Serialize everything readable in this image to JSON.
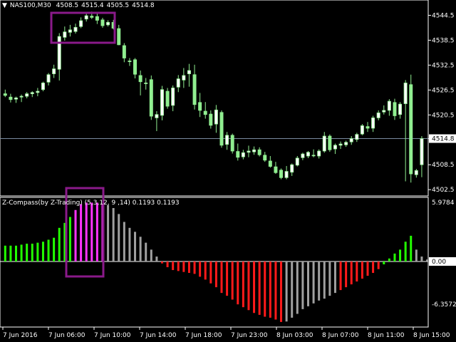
{
  "header": {
    "symbol_timeframe": "NAS100,M30",
    "ohlc": [
      "4508.5",
      "4515.4",
      "4505.5",
      "4514.8"
    ]
  },
  "price_axis": {
    "ticks": [
      "4544.5",
      "4538.5",
      "4532.5",
      "4526.5",
      "4520.5",
      "4514.8",
      "4508.5",
      "4502.5"
    ],
    "current_price": "4514.8"
  },
  "indicator": {
    "label": "Z-Compass(by Z-Trading) (5,3,12, 9 ,14) 0.1193 0.1193",
    "axis_ticks": [
      "5.9784",
      "0.00",
      "-6.3572"
    ]
  },
  "time_axis": {
    "labels": [
      "7 Jun 2016",
      "7 Jun 06:00",
      "7 Jun 10:00",
      "7 Jun 14:00",
      "7 Jun 18:00",
      "7 Jun 23:00",
      "8 Jun 03:00",
      "8 Jun 07:00",
      "8 Jun 11:00",
      "8 Jun 15:00"
    ]
  },
  "colors": {
    "background": "#000000",
    "bull_candle": "#ffffff",
    "bear_candle": "#90ee90",
    "wick": "#90ee90",
    "grid_axis": "#ffffff",
    "current_price_line": "#7a8aa0",
    "histogram_green": "#22ff00",
    "histogram_magenta": "#ff33ff",
    "histogram_gray": "#a0a0a0",
    "histogram_red": "#ff1a1a",
    "highlight_box": "#8a1a8a"
  },
  "chart_data": {
    "type": "candlestick",
    "y_range": [
      4501.5,
      4547.5
    ],
    "ohlc": [
      [
        4525.6,
        4526.6,
        4524.8,
        4525.2
      ],
      [
        4524.8,
        4525.6,
        4523.5,
        4524.2
      ],
      [
        4524.3,
        4524.9,
        4523.4,
        4524.6
      ],
      [
        4524.8,
        4525.4,
        4523.6,
        4525.0
      ],
      [
        4525.0,
        4526.0,
        4524.5,
        4525.6
      ],
      [
        4525.6,
        4526.2,
        4524.8,
        4525.9
      ],
      [
        4525.9,
        4527.0,
        4525.0,
        4526.2
      ],
      [
        4526.6,
        4528.5,
        4526.2,
        4528.2
      ],
      [
        4528.4,
        4530.6,
        4527.6,
        4530.2
      ],
      [
        4530.4,
        4532.6,
        4529.4,
        4531.6
      ],
      [
        4531.5,
        4540.2,
        4528.8,
        4539.4
      ],
      [
        4539.2,
        4541.8,
        4538.4,
        4540.5
      ],
      [
        4540.4,
        4542.2,
        4539.4,
        4541.0
      ],
      [
        4540.6,
        4542.5,
        4540.1,
        4541.6
      ],
      [
        4541.8,
        4544.0,
        4541.4,
        4543.2
      ],
      [
        4543.6,
        4545.2,
        4543.0,
        4544.4
      ],
      [
        4544.3,
        4545.4,
        4543.6,
        4544.0
      ],
      [
        4544.2,
        4545.3,
        4542.4,
        4543.3
      ],
      [
        4543.4,
        4543.9,
        4541.5,
        4542.0
      ],
      [
        4542.2,
        4543.3,
        4541.8,
        4542.8
      ],
      [
        4542.8,
        4543.4,
        4541.1,
        4541.4
      ],
      [
        4541.3,
        4542.2,
        4537.3,
        4537.4
      ],
      [
        4537.2,
        4537.8,
        4533.2,
        4534.2
      ],
      [
        4533.4,
        4534.2,
        4532.3,
        4533.5
      ],
      [
        4533.8,
        4534.2,
        4529.3,
        4530.3
      ],
      [
        4530.0,
        4531.2,
        4525.2,
        4528.5
      ],
      [
        4528.2,
        4529.4,
        4526.6,
        4528.2
      ],
      [
        4529.0,
        4530.0,
        4519.3,
        4520.2
      ],
      [
        4519.8,
        4521.4,
        4516.6,
        4520.6
      ],
      [
        4520.4,
        4527.5,
        4519.2,
        4526.6
      ],
      [
        4526.2,
        4527.0,
        4522.0,
        4522.6
      ],
      [
        4522.8,
        4527.6,
        4521.4,
        4527.0
      ],
      [
        4527.2,
        4530.1,
        4526.0,
        4529.2
      ],
      [
        4528.9,
        4531.8,
        4527.0,
        4530.0
      ],
      [
        4530.4,
        4532.8,
        4527.3,
        4531.2
      ],
      [
        4530.2,
        4532.6,
        4521.8,
        4523.0
      ],
      [
        4523.5,
        4525.8,
        4520.0,
        4521.6
      ],
      [
        4521.4,
        4523.6,
        4519.6,
        4520.6
      ],
      [
        4520.7,
        4521.6,
        4517.2,
        4518.0
      ],
      [
        4518.3,
        4522.9,
        4516.2,
        4521.7
      ],
      [
        4521.1,
        4521.6,
        4512.6,
        4513.2
      ],
      [
        4513.4,
        4516.4,
        4512.1,
        4515.6
      ],
      [
        4515.6,
        4516.0,
        4511.2,
        4511.8
      ],
      [
        4511.7,
        4513.6,
        4509.5,
        4510.3
      ],
      [
        4510.4,
        4512.1,
        4509.8,
        4511.4
      ],
      [
        4511.5,
        4513.1,
        4510.3,
        4511.8
      ],
      [
        4511.6,
        4512.9,
        4510.9,
        4512.1
      ],
      [
        4512.1,
        4512.7,
        4510.5,
        4510.9
      ],
      [
        4510.8,
        4511.6,
        4509.2,
        4509.6
      ],
      [
        4509.4,
        4510.6,
        4507.8,
        4508.1
      ],
      [
        4508.0,
        4509.2,
        4506.3,
        4506.6
      ],
      [
        4507.2,
        4507.6,
        4505.0,
        4505.4
      ],
      [
        4505.4,
        4508.2,
        4505.0,
        4506.9
      ],
      [
        4506.7,
        4508.8,
        4505.8,
        4508.5
      ],
      [
        4508.4,
        4510.6,
        4508.1,
        4510.1
      ],
      [
        4510.2,
        4511.4,
        4509.6,
        4511.1
      ],
      [
        4510.6,
        4511.8,
        4510.1,
        4511.5
      ],
      [
        4510.8,
        4512.2,
        4510.3,
        4510.8
      ],
      [
        4510.6,
        4512.2,
        4510.0,
        4511.8
      ],
      [
        4511.8,
        4516.4,
        4511.4,
        4515.4
      ],
      [
        4515.4,
        4515.8,
        4511.6,
        4512.1
      ],
      [
        4512.3,
        4513.6,
        4511.1,
        4513.2
      ],
      [
        4513.2,
        4514.1,
        4512.3,
        4513.5
      ],
      [
        4513.3,
        4514.3,
        4512.8,
        4513.9
      ],
      [
        4514.0,
        4515.4,
        4513.3,
        4514.8
      ],
      [
        4514.6,
        4516.2,
        4514.0,
        4515.8
      ],
      [
        4515.9,
        4518.3,
        4515.6,
        4517.9
      ],
      [
        4517.7,
        4518.8,
        4516.4,
        4517.3
      ],
      [
        4517.3,
        4520.3,
        4516.4,
        4519.8
      ],
      [
        4519.8,
        4521.6,
        4519.2,
        4521.0
      ],
      [
        4521.2,
        4522.8,
        4520.6,
        4521.6
      ],
      [
        4521.6,
        4524.3,
        4520.3,
        4523.8
      ],
      [
        4523.5,
        4524.4,
        4519.3,
        4520.3
      ],
      [
        4520.6,
        4523.6,
        4519.6,
        4523.1
      ],
      [
        4523.2,
        4528.9,
        4504.5,
        4528.2
      ],
      [
        4527.8,
        4530.2,
        4504.2,
        4506.3
      ],
      [
        4506.1,
        4507.5,
        4505.4,
        4507.1
      ],
      [
        4508.5,
        4515.4,
        4505.5,
        4514.8
      ]
    ],
    "indicator": {
      "name": "Z-Compass(by Z-Trading) (5,3,12, 9 ,14)",
      "values": [
        1.6,
        1.6,
        1.6,
        1.7,
        1.8,
        1.8,
        1.9,
        2.0,
        2.2,
        2.4,
        3.4,
        3.9,
        4.5,
        5.2,
        5.8,
        5.95,
        5.95,
        5.95,
        5.8,
        5.7,
        5.4,
        4.8,
        4.0,
        3.4,
        3.0,
        2.5,
        1.9,
        1.2,
        0.5,
        -0.2,
        -0.6,
        -0.9,
        -1.0,
        -1.1,
        -1.2,
        -1.3,
        -1.6,
        -1.9,
        -2.3,
        -2.7,
        -3.3,
        -3.6,
        -4.0,
        -4.5,
        -4.8,
        -5.1,
        -5.4,
        -5.6,
        -5.8,
        -5.9,
        -6.1,
        -6.35,
        -6.3,
        -5.9,
        -5.5,
        -5.0,
        -4.7,
        -4.4,
        -4.1,
        -3.9,
        -3.6,
        -3.3,
        -3.0,
        -2.7,
        -2.4,
        -2.1,
        -1.8,
        -1.5,
        -1.2,
        -0.8,
        -0.3,
        0.3,
        0.8,
        1.2,
        2.0,
        2.6,
        1.2,
        0.5,
        0.2,
        0.12
      ],
      "colors": [
        "g",
        "g",
        "g",
        "g",
        "g",
        "g",
        "g",
        "g",
        "g",
        "g",
        "g",
        "g",
        "g",
        "m",
        "m",
        "m",
        "m",
        "m",
        "m",
        "s",
        "s",
        "s",
        "s",
        "s",
        "s",
        "s",
        "s",
        "s",
        "s",
        "r",
        "r",
        "r",
        "r",
        "r",
        "r",
        "r",
        "r",
        "r",
        "r",
        "r",
        "r",
        "r",
        "r",
        "r",
        "r",
        "r",
        "r",
        "r",
        "r",
        "r",
        "r",
        "r",
        "s",
        "s",
        "s",
        "s",
        "s",
        "s",
        "s",
        "s",
        "s",
        "s",
        "r",
        "r",
        "r",
        "r",
        "r",
        "r",
        "r",
        "r",
        "g",
        "g",
        "g",
        "g",
        "g",
        "g",
        "s",
        "s",
        "s",
        "s"
      ]
    }
  }
}
